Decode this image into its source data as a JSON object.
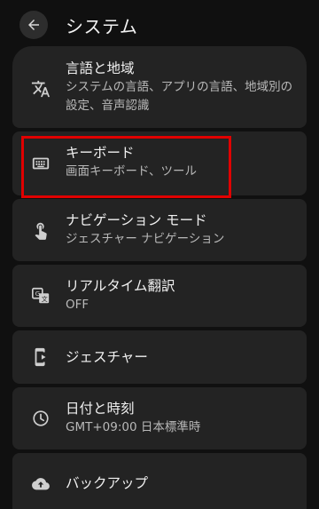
{
  "header": {
    "title": "システム"
  },
  "items": [
    {
      "title": "言語と地域",
      "subtitle": "システムの言語、アプリの言語、地域別の設定、音声認識",
      "icon": "translate-icon"
    },
    {
      "title": "キーボード",
      "subtitle": "画面キーボード、ツール",
      "icon": "keyboard-icon"
    },
    {
      "title": "ナビゲーション モード",
      "subtitle": "ジェスチャー ナビゲーション",
      "icon": "gesture-hand-icon"
    },
    {
      "title": "リアルタイム翻訳",
      "subtitle": "OFF",
      "icon": "live-translate-icon"
    },
    {
      "title": "ジェスチャー",
      "icon": "gesture-phone-icon"
    },
    {
      "title": "日付と時刻",
      "subtitle": "GMT+09:00 日本標準時",
      "icon": "clock-icon"
    },
    {
      "title": "バックアップ",
      "icon": "cloud-backup-icon"
    }
  ],
  "colors": {
    "background": "#101010",
    "card": "#232323",
    "highlight": "#e00000"
  }
}
